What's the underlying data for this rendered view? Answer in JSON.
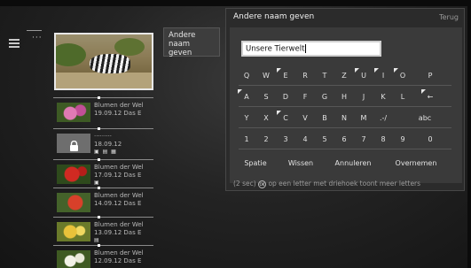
{
  "dialog": {
    "title": "Andere naam geven",
    "back_label": "Terug",
    "input_value": "Unsere Tierwelt",
    "hint_pre": "(2 sec)",
    "hint_ok": "OK",
    "hint_post": "op een letter met driehoek toont meer letters"
  },
  "keyboard": {
    "rows": [
      [
        "Q",
        "W",
        "E",
        "R",
        "T",
        "Z",
        "U",
        "I",
        "O",
        "P"
      ],
      [
        "A",
        "S",
        "D",
        "F",
        "G",
        "H",
        "J",
        "K",
        "L",
        "←"
      ],
      [
        "Y",
        "X",
        "C",
        "V",
        "B",
        "N",
        "M",
        ".-/",
        "abc"
      ],
      [
        "1",
        "2",
        "3",
        "4",
        "5",
        "6",
        "7",
        "8",
        "9",
        "0"
      ]
    ],
    "bottom": [
      "Spatie",
      "Wissen",
      "Annuleren",
      "Overnemen"
    ]
  },
  "menu": {
    "dots": "···",
    "submenu_label": "Andere naam geven"
  },
  "list": [
    {
      "title": "Blumen der Wel",
      "meta": "19.09.12 Das E",
      "icons": "",
      "thumb": "flowers-pink"
    },
    {
      "title": "·········",
      "meta": "18.09.12",
      "icons": "▣ ▤ ▦",
      "thumb": "locked"
    },
    {
      "title": "Blumen der Wel",
      "meta": "17.09.12 Das E",
      "icons": "▣",
      "thumb": "flowers-red"
    },
    {
      "title": "Blumen der Wel",
      "meta": "14.09.12 Das E",
      "icons": "",
      "thumb": "flowers-red2"
    },
    {
      "title": "Blumen der Wel",
      "meta": "13.09.12 Das E",
      "icons": "▤",
      "thumb": "flowers-yellow"
    },
    {
      "title": "Blumen der Wel",
      "meta": "12.09.12 Das E",
      "icons": "",
      "thumb": "flowers-white"
    }
  ],
  "colors": {
    "dialog_bg": "#2b2b2b",
    "keyboard_bg": "#3a3a3a",
    "accent_white": "#ffffff"
  },
  "icons": {
    "menu": "list-icon",
    "lock": "lock-icon",
    "key_more": "triangle-marker"
  }
}
